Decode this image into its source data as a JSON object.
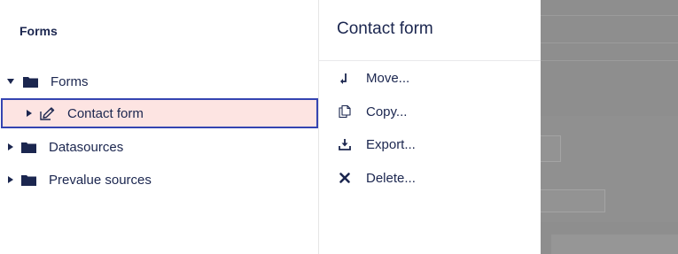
{
  "tree": {
    "header": "Forms",
    "items": [
      {
        "label": "Forms",
        "expanded": true,
        "icon": "folder-icon"
      },
      {
        "label": "Contact form",
        "selected": true,
        "icon": "edit-form-icon"
      },
      {
        "label": "Datasources",
        "expanded": false,
        "icon": "folder-icon"
      },
      {
        "label": "Prevalue sources",
        "expanded": false,
        "icon": "folder-icon"
      }
    ]
  },
  "actions": {
    "title": "Contact form",
    "items": [
      {
        "label": "Move...",
        "icon": "move-icon"
      },
      {
        "label": "Copy...",
        "icon": "copy-icon"
      },
      {
        "label": "Export...",
        "icon": "export-icon"
      },
      {
        "label": "Delete...",
        "icon": "delete-icon"
      }
    ]
  },
  "colors": {
    "text": "#1b264f",
    "selected_bg": "#fde4e2",
    "selected_border": "#3544b1",
    "overlay": "#8e8e8e"
  }
}
